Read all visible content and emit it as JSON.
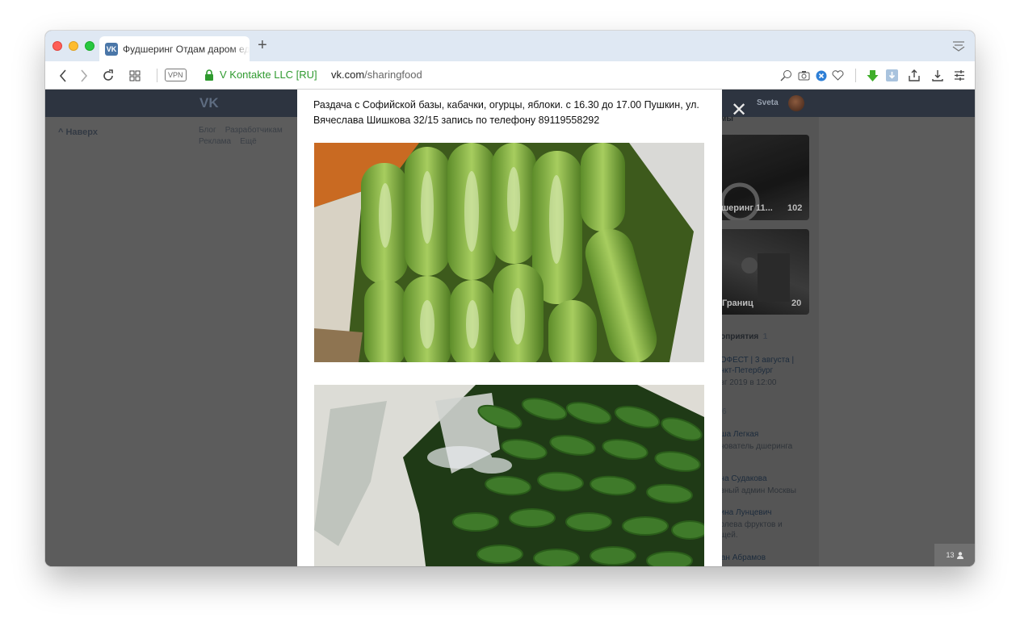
{
  "browser": {
    "tab_title": "Фудшеринг Отдам даром ед",
    "tab_favicon": "VK",
    "new_tab": "+",
    "vpn_label": "VPN",
    "certificate": "V Kontakte LLC [RU]",
    "url_host": "vk.com",
    "url_path": "/sharingfood"
  },
  "vk": {
    "logo": "VK",
    "user_name": "Sveta",
    "back_to_top": "Наверх",
    "footer_links": [
      "Блог",
      "Разработчикам",
      "Реклама",
      "Ещё"
    ],
    "album_section": "омы",
    "album1_title": "дшеринг 11...",
    "album1_count": "102",
    "album2_title": "Границ",
    "album2_count": "20",
    "events_header": "роприятия",
    "events_count": "1",
    "event_title": "КОФЕСТ | 3 августа | анкт-Петербург",
    "event_date": "авг 2019 в 12:00",
    "contacts_count": "6",
    "contacts": [
      {
        "name": "аша Легкая",
        "role": "снователь дшеринга"
      },
      {
        "name": "ена Судакова",
        "role": "авный админ Москвы"
      },
      {
        "name": "рина Лунцевич",
        "role": "ролева фруктов и ощей."
      },
      {
        "name": "ман Абрамов",
        "role": ""
      }
    ],
    "viewers_count": "13"
  },
  "post": {
    "caption": "Раздача с Софийской базы, кабачки, огурцы, яблоки. с 16.30 до 17.00 Пушкин, ул. Вячеслава Шишкова 32/15 запись по телефону 89119558292",
    "photo1": "zucchini-in-box",
    "photo2": "cucumbers-in-bag"
  },
  "colors": {
    "vk_blue": "#4a76a8",
    "secure_green": "#2f9a2f",
    "overlay": "#5c5c5c"
  }
}
